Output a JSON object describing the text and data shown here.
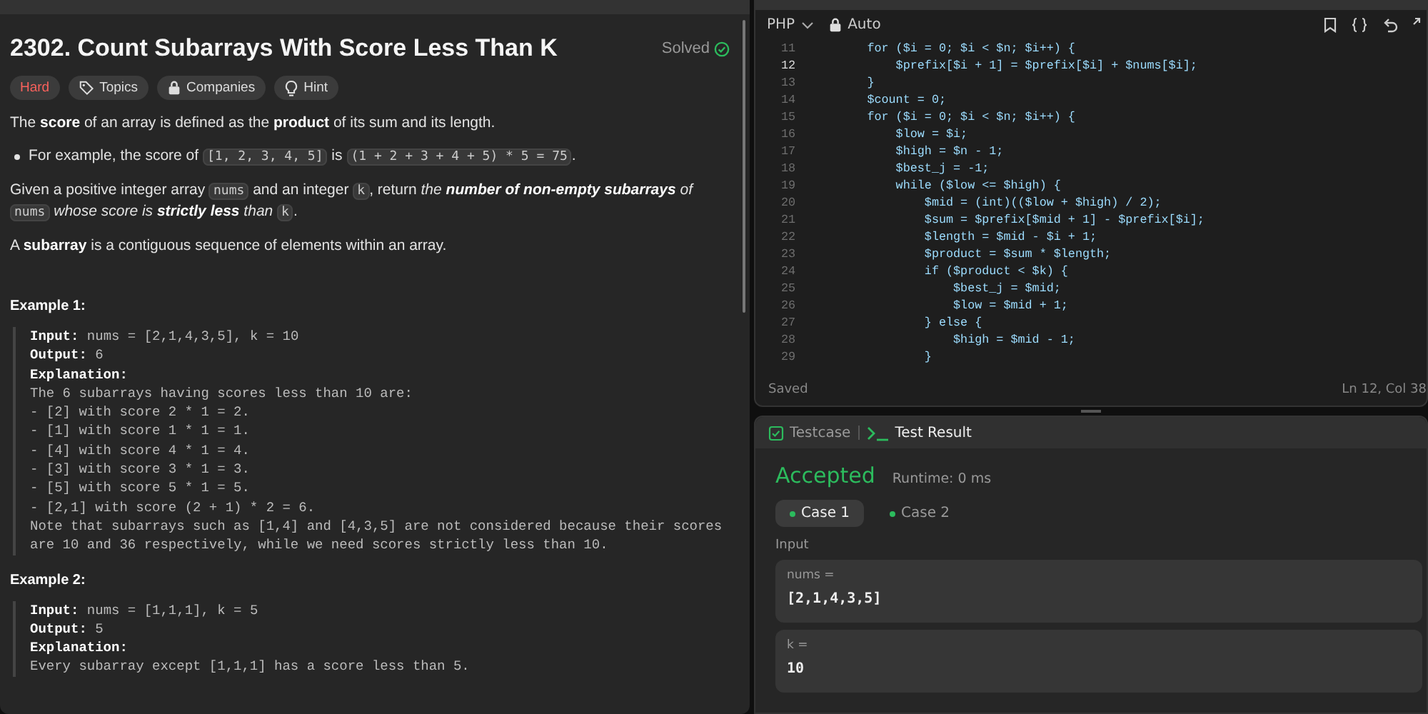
{
  "problem": {
    "title": "2302. Count Subarrays With Score Less Than K",
    "status": "Solved",
    "solved": true,
    "tags": [
      {
        "kind": "difficulty",
        "label": "Hard"
      },
      {
        "kind": "topics",
        "label": "Topics"
      },
      {
        "kind": "companies",
        "label": "Companies"
      },
      {
        "kind": "hint",
        "label": "Hint"
      }
    ],
    "paragraphs": [
      {
        "bullet": false,
        "parts": [
          {
            "kind": "text",
            "text": "The **score** of an array is defined as the **product** of its sum and its length."
          }
        ]
      },
      {
        "bullet": true,
        "parts": [
          {
            "kind": "text",
            "text": "For example, the score of "
          },
          {
            "kind": "code",
            "text": "[1, 2, 3, 4, 5]"
          },
          {
            "kind": "text",
            "text": " is "
          },
          {
            "kind": "code",
            "text": "(1 + 2 + 3 + 4 + 5) * 5 = 75"
          },
          {
            "kind": "text",
            "text": "."
          }
        ]
      },
      {
        "bullet": false,
        "parts": [
          {
            "kind": "text",
            "text": "Given a positive integer array "
          },
          {
            "kind": "code",
            "text": "nums"
          },
          {
            "kind": "text",
            "text": " and an integer "
          },
          {
            "kind": "code",
            "text": "k"
          },
          {
            "kind": "text",
            "text": ", return "
          },
          {
            "kind": "em",
            "text": "the **number of non-empty subarrays** of "
          },
          {
            "kind": "code",
            "text": "nums"
          },
          {
            "kind": "em",
            "text": " whose score is **strictly less** than "
          },
          {
            "kind": "code",
            "text": "k"
          },
          {
            "kind": "text",
            "text": "."
          }
        ]
      },
      {
        "bullet": false,
        "parts": [
          {
            "kind": "text",
            "text": "A **subarray** is a contiguous sequence of elements within an array."
          }
        ]
      }
    ],
    "examples": [
      {
        "heading": "Example 1:",
        "lines": [
          "**Input:** nums = [2,1,4,3,5], k = 10",
          "**Output:** 6",
          "**Explanation:**",
          "The 6 subarrays having scores less than 10 are:",
          "- [2] with score 2 * 1 = 2.",
          "- [1] with score 1 * 1 = 1.",
          "- [4] with score 4 * 1 = 4.",
          "- [3] with score 3 * 1 = 3.",
          "- [5] with score 5 * 1 = 5.",
          "- [2,1] with score (2 + 1) * 2 = 6.",
          "Note that subarrays such as [1,4] and [4,3,5] are not considered because their scores are 10 and 36 respectively, while we need scores strictly less than 10."
        ]
      },
      {
        "heading": "Example 2:",
        "lines": [
          "**Input:** nums = [1,1,1], k = 5",
          "**Output:** 5",
          "**Explanation:**",
          "Every subarray except [1,1,1] has a score less than 5."
        ]
      }
    ]
  },
  "editor": {
    "language": "PHP",
    "mode": "Auto",
    "lines": [
      {
        "number": "11",
        "active": false,
        "code": "        for ($i = 0; $i < $n; $i++) {"
      },
      {
        "number": "12",
        "active": true,
        "code": "            $prefix[$i + 1] = $prefix[$i] + $nums[$i];"
      },
      {
        "number": "13",
        "active": false,
        "code": "        }"
      },
      {
        "number": "14",
        "active": false,
        "code": "        $count = 0;"
      },
      {
        "number": "15",
        "active": false,
        "code": "        for ($i = 0; $i < $n; $i++) {"
      },
      {
        "number": "16",
        "active": false,
        "code": "            $low = $i;"
      },
      {
        "number": "17",
        "active": false,
        "code": "            $high = $n - 1;"
      },
      {
        "number": "18",
        "active": false,
        "code": "            $best_j = -1;"
      },
      {
        "number": "19",
        "active": false,
        "code": "            while ($low <= $high) {"
      },
      {
        "number": "20",
        "active": false,
        "code": "                $mid = (int)(($low + $high) / 2);"
      },
      {
        "number": "21",
        "active": false,
        "code": "                $sum = $prefix[$mid + 1] - $prefix[$i];"
      },
      {
        "number": "22",
        "active": false,
        "code": "                $length = $mid - $i + 1;"
      },
      {
        "number": "23",
        "active": false,
        "code": "                $product = $sum * $length;"
      },
      {
        "number": "24",
        "active": false,
        "code": "                if ($product < $k) {"
      },
      {
        "number": "25",
        "active": false,
        "code": "                    $best_j = $mid;"
      },
      {
        "number": "26",
        "active": false,
        "code": "                    $low = $mid + 1;"
      },
      {
        "number": "27",
        "active": false,
        "code": "                } else {"
      },
      {
        "number": "28",
        "active": false,
        "code": "                    $high = $mid - 1;"
      },
      {
        "number": "29",
        "active": false,
        "code": "                }"
      }
    ],
    "status": "Saved",
    "cursor": "Ln 12, Col 38"
  },
  "tests": {
    "tabs": [
      {
        "kind": "testcase",
        "label": "Testcase",
        "selected": false
      },
      {
        "kind": "result",
        "label": "Test Result",
        "selected": true
      }
    ],
    "verdict": "Accepted",
    "runtime": "Runtime: 0 ms",
    "cases": [
      {
        "label": "Case 1",
        "selected": true
      },
      {
        "label": "Case 2",
        "selected": false
      }
    ],
    "input_label": "Input",
    "inputs": [
      {
        "name": "nums =",
        "value": "[2,1,4,3,5]"
      },
      {
        "name": "k =",
        "value": "10"
      }
    ]
  }
}
